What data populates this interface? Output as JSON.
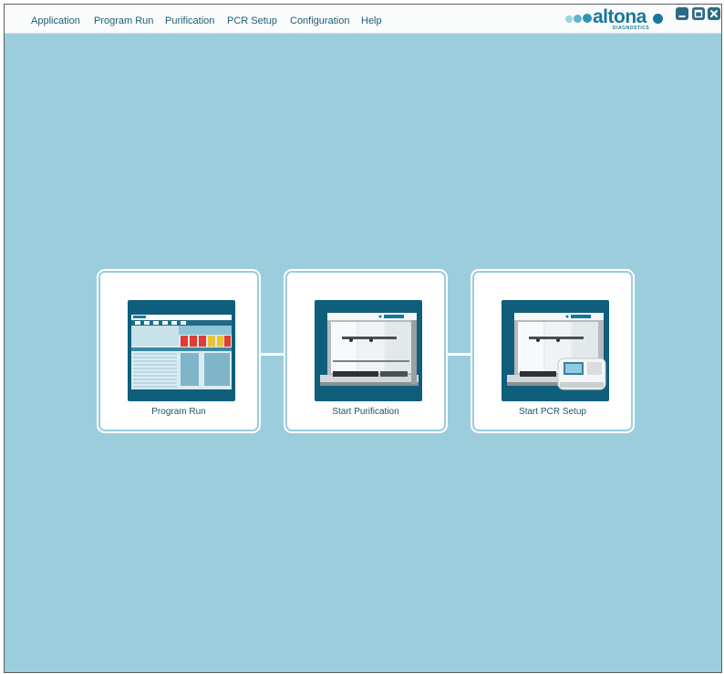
{
  "menu": {
    "items": [
      {
        "label": "Application"
      },
      {
        "label": "Program Run"
      },
      {
        "label": "Purification"
      },
      {
        "label": "PCR Setup"
      },
      {
        "label": "Configuration"
      },
      {
        "label": "Help"
      }
    ]
  },
  "logo": {
    "brand": "altona",
    "tagline": "DIAGNOSTICS"
  },
  "window_controls": {
    "minimize_icon": "minimize-icon",
    "maximize_icon": "maximize-icon",
    "close_icon": "close-icon"
  },
  "tiles": [
    {
      "label": "Program Run",
      "thumbnail": "program-run-screen-thumbnail"
    },
    {
      "label": "Start Purification",
      "thumbnail": "purification-instrument-thumbnail"
    },
    {
      "label": "Start PCR Setup",
      "thumbnail": "pcr-setup-instrument-thumbnail"
    }
  ],
  "colors": {
    "background": "#9ccddc",
    "menubar": "#fafbfb",
    "menu_text": "#1f5d78",
    "brand": "#16799a",
    "tile_thumb": "#0f5f7c"
  }
}
